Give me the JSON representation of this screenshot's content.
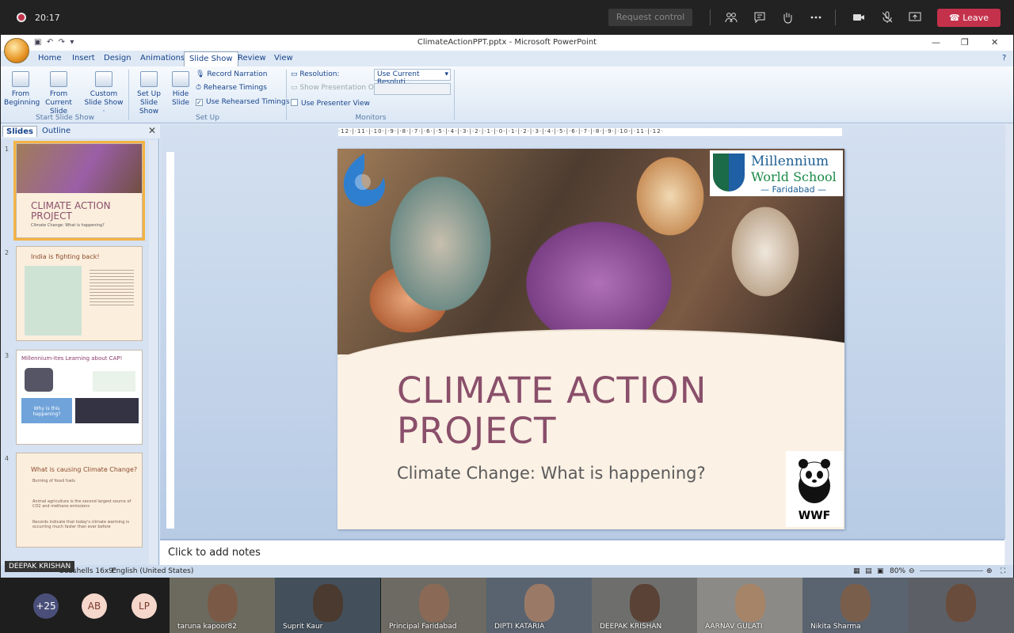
{
  "meeting": {
    "time": "20:17",
    "request_control": "Request control",
    "leave": "Leave",
    "icons": [
      "people-icon",
      "chat-icon",
      "raise-hand-icon",
      "more-icon",
      "camera-icon",
      "mic-off-icon",
      "share-icon",
      "phone-icon"
    ]
  },
  "ppt": {
    "window_title": "ClimateActionPPT.pptx - Microsoft PowerPoint",
    "tabs": [
      "Home",
      "Insert",
      "Design",
      "Animations",
      "Slide Show",
      "Review",
      "View"
    ],
    "active_tab": "Slide Show",
    "ribbon": {
      "from_beginning": [
        "From",
        "Beginning"
      ],
      "from_current": [
        "From",
        "Current Slide"
      ],
      "custom_show": [
        "Custom",
        "Slide Show ·"
      ],
      "group_start": "Start Slide Show",
      "setup_show": [
        "Set Up",
        "Slide Show"
      ],
      "hide_slide": [
        "Hide",
        "Slide"
      ],
      "record_narration": "Record Narration",
      "rehearse_timings": "Rehearse Timings",
      "use_rehearsed": "Use Rehearsed Timings",
      "group_setup": "Set Up",
      "resolution_label": "Resolution:",
      "resolution_value": "Use Current Resoluti...",
      "show_presentation_on": "Show Presentation On:",
      "use_presenter_view": "Use Presenter View",
      "group_monitors": "Monitors"
    },
    "pane": {
      "tab_slides": "Slides",
      "tab_outline": "Outline",
      "thumbs": [
        {
          "num": "1",
          "title": "CLIMATE ACTION PROJECT",
          "sub": "Climate Change: What is happening?"
        },
        {
          "num": "2",
          "title": "India is fighting back!"
        },
        {
          "num": "3",
          "title": "Millennium-ites Learning about CAP!",
          "box": "Why is this happening?"
        },
        {
          "num": "4",
          "title": "What is causing Climate Change?",
          "bullets": [
            "Burning of fossil fuels",
            "Animal agriculture is the second largest source of CO2 and methane emissions",
            "Records indicate that today's climate warming is occurring much faster than ever before"
          ]
        }
      ]
    },
    "ruler_text": "·12·|·11·|·10·|·9·|·8·|·7·|·6·|·5·|·4·|·3·|·2·|·1·|·0·|·1·|·2·|·3·|·4·|·5·|·6·|·7·|·8·|·9·|·10·|·11·|·12·",
    "slide": {
      "title_line1": "CLIMATE ACTION",
      "title_line2": "PROJECT",
      "subtitle": "Climate Change: What is happening?",
      "brand_l1": "Millennium",
      "brand_l2": "World School",
      "brand_l3": "— Faridabad —",
      "wwf": "WWF"
    },
    "notes_placeholder": "Click to add notes",
    "status": {
      "theme": "\"Seashells 16x9\"",
      "language": "English (United States)",
      "zoom": "80%"
    }
  },
  "presenter_caption": "DEEPAK KRISHAN",
  "participants": {
    "avatars": [
      {
        "label": "+25",
        "color": "#4a4f7a"
      },
      {
        "label": "AB",
        "color": "#f6d7cc"
      },
      {
        "label": "LP",
        "color": "#f6d7cc"
      }
    ],
    "tiles": [
      {
        "name": "taruna kapoor82",
        "bg": "#6c6a5f"
      },
      {
        "name": "Suprit Kaur",
        "bg": "#43505c"
      },
      {
        "name": "Principal Faridabad",
        "bg": "#6d6a63"
      },
      {
        "name": "DIPTI KATARIA",
        "bg": "#59636f"
      },
      {
        "name": "DEEPAK KRISHAN",
        "bg": "#6e6f6d"
      },
      {
        "name": "AARNAV GULATI",
        "bg": "#8b8a86"
      },
      {
        "name": "Nikita Sharma",
        "bg": "#5a6470"
      },
      {
        "name": "",
        "bg": "#5c6066"
      }
    ]
  }
}
